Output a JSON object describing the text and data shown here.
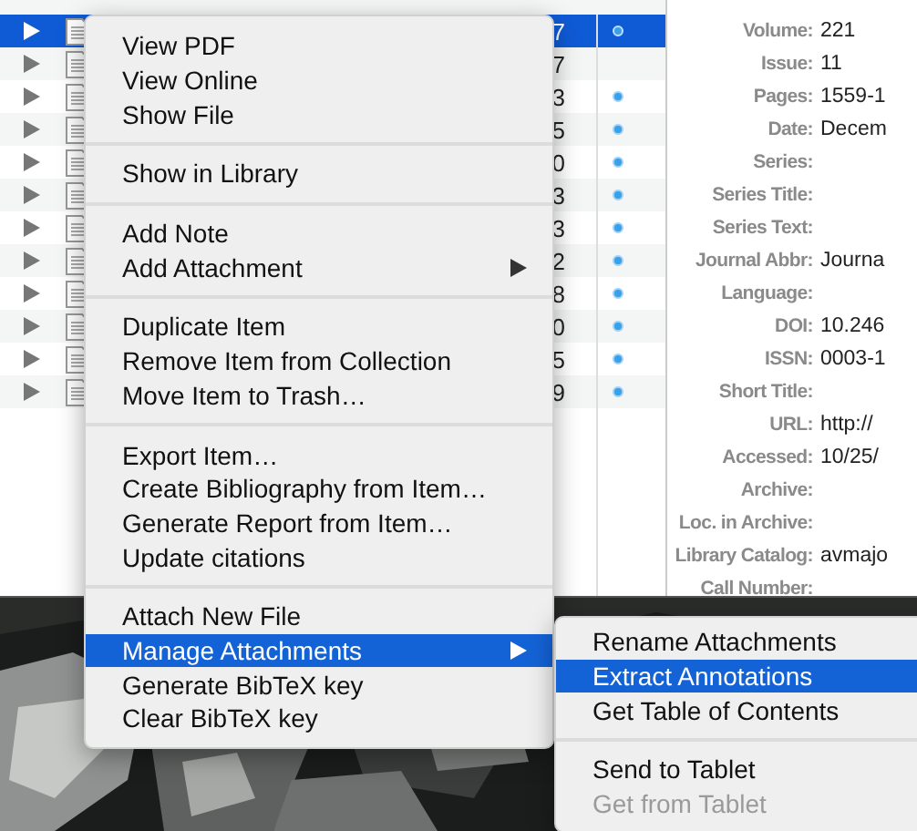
{
  "table": {
    "rows": [
      {
        "selected": true,
        "column_5": "7",
        "dot": true
      },
      {
        "selected": false,
        "column_5": "7",
        "dot": false
      },
      {
        "selected": false,
        "column_5": "3",
        "dot": true
      },
      {
        "selected": false,
        "column_5": "5",
        "dot": true
      },
      {
        "selected": false,
        "column_5": "0",
        "dot": true
      },
      {
        "selected": false,
        "column_5": "3",
        "dot": true
      },
      {
        "selected": false,
        "column_5": "3",
        "dot": true
      },
      {
        "selected": false,
        "column_5": "2",
        "dot": true
      },
      {
        "selected": false,
        "column_5": "8",
        "dot": true
      },
      {
        "selected": false,
        "column_5": "0",
        "dot": true
      },
      {
        "selected": false,
        "column_5": "5",
        "dot": true
      },
      {
        "selected": false,
        "column_5": "9",
        "dot": true
      }
    ]
  },
  "info_pane": {
    "fields": [
      {
        "label": "Volume:",
        "value": "221"
      },
      {
        "label": "Issue:",
        "value": "11"
      },
      {
        "label": "Pages:",
        "value": "1559-1"
      },
      {
        "label": "Date:",
        "value": "Decem"
      },
      {
        "label": "Series:"
      },
      {
        "label": "Series Title:"
      },
      {
        "label": "Series Text:"
      },
      {
        "label": "Journal Abbr:",
        "value": "Journa"
      },
      {
        "label": "Language:"
      },
      {
        "label": "DOI:",
        "value": "10.246"
      },
      {
        "label": "ISSN:",
        "value": "0003-1"
      },
      {
        "label": "Short Title:"
      },
      {
        "label": "URL:",
        "value": "http://"
      },
      {
        "label": "Accessed:",
        "value": "10/25/"
      },
      {
        "label": "Archive:"
      },
      {
        "label": "Loc. in Archive:"
      },
      {
        "label": "Library Catalog:",
        "value": "avmajo"
      },
      {
        "label": "Call Number:"
      }
    ]
  },
  "context_menu": {
    "items": [
      {
        "kind": "item",
        "label": "View PDF",
        "selected": false
      },
      {
        "kind": "item",
        "label": "View Online",
        "selected": false
      },
      {
        "kind": "item",
        "label": "Show File",
        "selected": false
      },
      {
        "kind": "separator"
      },
      {
        "kind": "item",
        "label": "Show in Library",
        "selected": false
      },
      {
        "kind": "separator"
      },
      {
        "kind": "item",
        "label": "Add Note",
        "selected": false
      },
      {
        "kind": "submenu",
        "label": "Add Attachment",
        "selected": false
      },
      {
        "kind": "separator"
      },
      {
        "kind": "item",
        "label": "Duplicate Item",
        "selected": false
      },
      {
        "kind": "item",
        "label": "Remove Item from Collection",
        "selected": false
      },
      {
        "kind": "item",
        "label": "Move Item to Trash…",
        "selected": false
      },
      {
        "kind": "separator"
      },
      {
        "kind": "item",
        "label": "Export Item…",
        "selected": false
      },
      {
        "kind": "item",
        "label": "Create Bibliography from Item…",
        "selected": false
      },
      {
        "kind": "item",
        "label": "Generate Report from Item…",
        "selected": false
      },
      {
        "kind": "item",
        "label": "Update citations",
        "selected": false
      },
      {
        "kind": "separator"
      },
      {
        "kind": "item",
        "label": "Attach New File",
        "selected": false
      },
      {
        "kind": "submenu",
        "label": "Manage Attachments",
        "selected": true
      },
      {
        "kind": "item",
        "label": "Generate BibTeX key",
        "selected": false
      },
      {
        "kind": "item",
        "label": "Clear BibTeX key",
        "selected": false
      }
    ]
  },
  "submenu": {
    "items": [
      {
        "kind": "item",
        "label": "Rename Attachments",
        "selected": false,
        "disabled": false
      },
      {
        "kind": "item",
        "label": "Extract Annotations",
        "selected": true,
        "disabled": false
      },
      {
        "kind": "item",
        "label": "Get Table of Contents",
        "selected": false,
        "disabled": false
      },
      {
        "kind": "separator"
      },
      {
        "kind": "item",
        "label": "Send to Tablet",
        "selected": false,
        "disabled": false
      },
      {
        "kind": "item",
        "label": "Get from Tablet",
        "selected": false,
        "disabled": true
      }
    ]
  }
}
